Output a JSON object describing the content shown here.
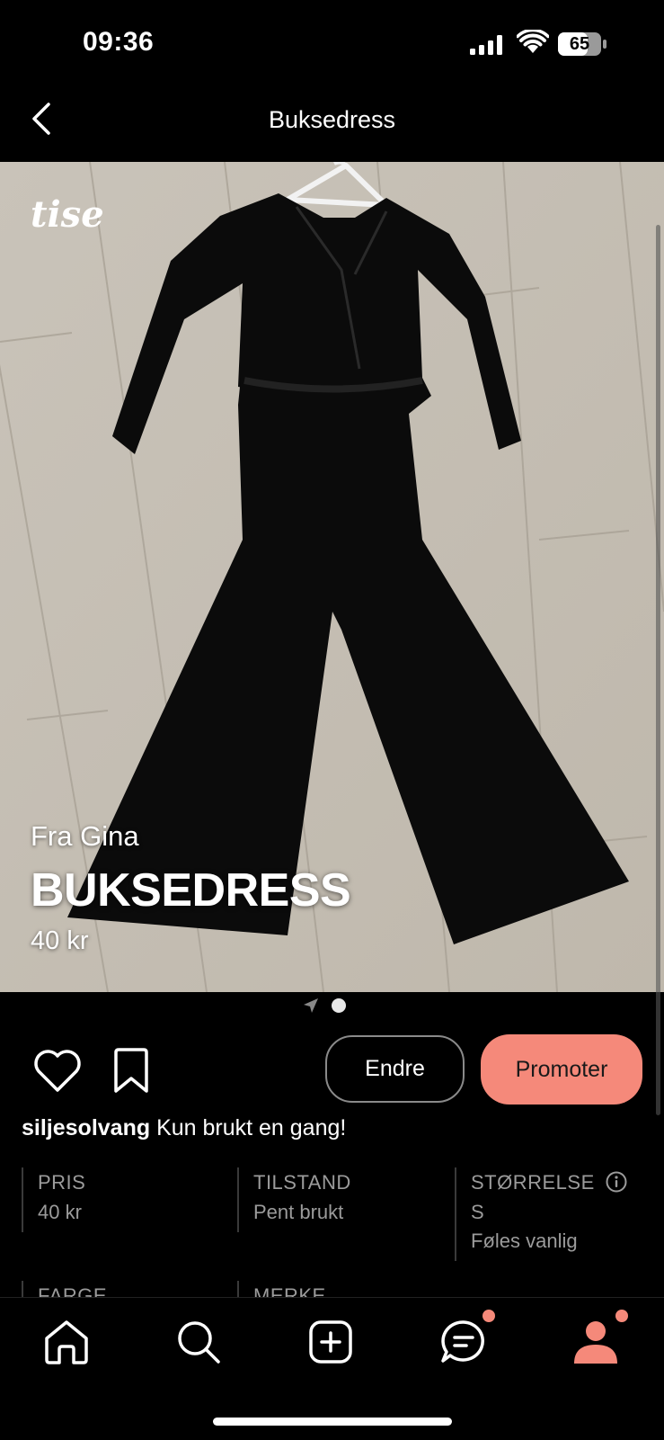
{
  "status_bar": {
    "time": "09:36",
    "battery": "65"
  },
  "nav": {
    "title": "Buksedress",
    "back_icon": "chevron-left-icon"
  },
  "photo": {
    "logo_text": "tise",
    "from_label": "Fra Gina",
    "item_name": "BUKSEDRESS",
    "price": "40 kr",
    "page_count": 1,
    "current_page": 1
  },
  "actions": {
    "heart_icon": "heart-icon",
    "bookmark_icon": "bookmark-icon",
    "edit_label": "Endre",
    "promote_label": "Promoter"
  },
  "caption": {
    "username": "siljesolvang",
    "text": " Kun brukt en gang!"
  },
  "details": {
    "price_label": "PRIS",
    "price_value": "40 kr",
    "condition_label": "TILSTAND",
    "condition_value": "Pent brukt",
    "size_label": "STØRRELSE",
    "size_value": "S",
    "size_fit": "Føles vanlig",
    "color_label": "FARGE",
    "brand_label": "MERKE"
  },
  "tabbar": {
    "tabs": [
      "home-icon",
      "search-icon",
      "add-icon",
      "messages-icon",
      "profile-icon"
    ]
  },
  "colors": {
    "accent": "#f5897a",
    "background": "#000000"
  }
}
